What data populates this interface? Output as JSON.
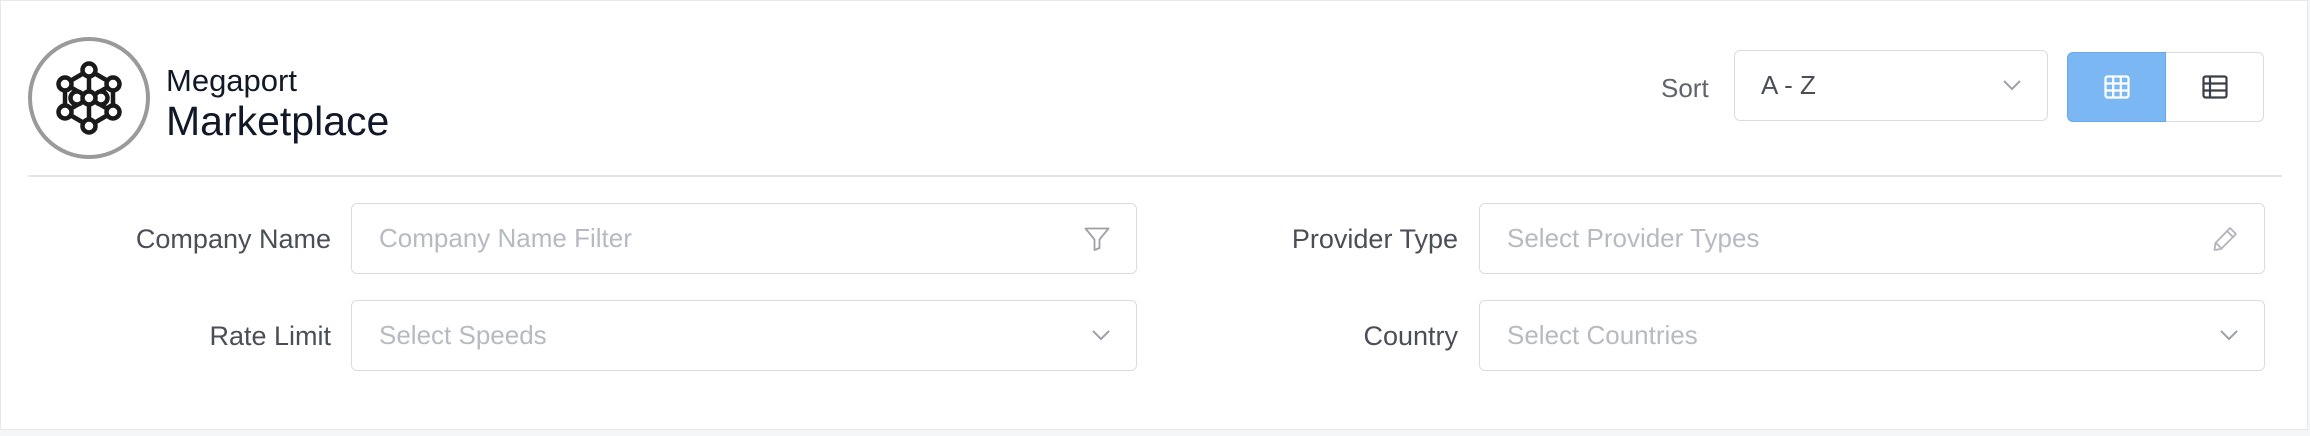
{
  "brand": {
    "name_top": "Megaport",
    "name_main": "Marketplace",
    "logo_icon": "network-nodes-icon"
  },
  "sort": {
    "label": "Sort",
    "selected": "A - Z",
    "icon": "chevron-down-icon"
  },
  "view_toggle": {
    "active": "grid",
    "grid_icon": "grid-view-icon",
    "list_icon": "list-view-icon",
    "active_color": "#7ab7f3"
  },
  "filters": {
    "company_name": {
      "label": "Company Name",
      "placeholder": "Company Name Filter",
      "icon": "filter-icon"
    },
    "provider_type": {
      "label": "Provider Type",
      "placeholder": "Select Provider Types",
      "icon": "pencil-icon"
    },
    "rate_limit": {
      "label": "Rate Limit",
      "placeholder": "Select Speeds",
      "icon": "chevron-down-icon"
    },
    "country": {
      "label": "Country",
      "placeholder": "Select Countries",
      "icon": "chevron-down-icon"
    }
  }
}
